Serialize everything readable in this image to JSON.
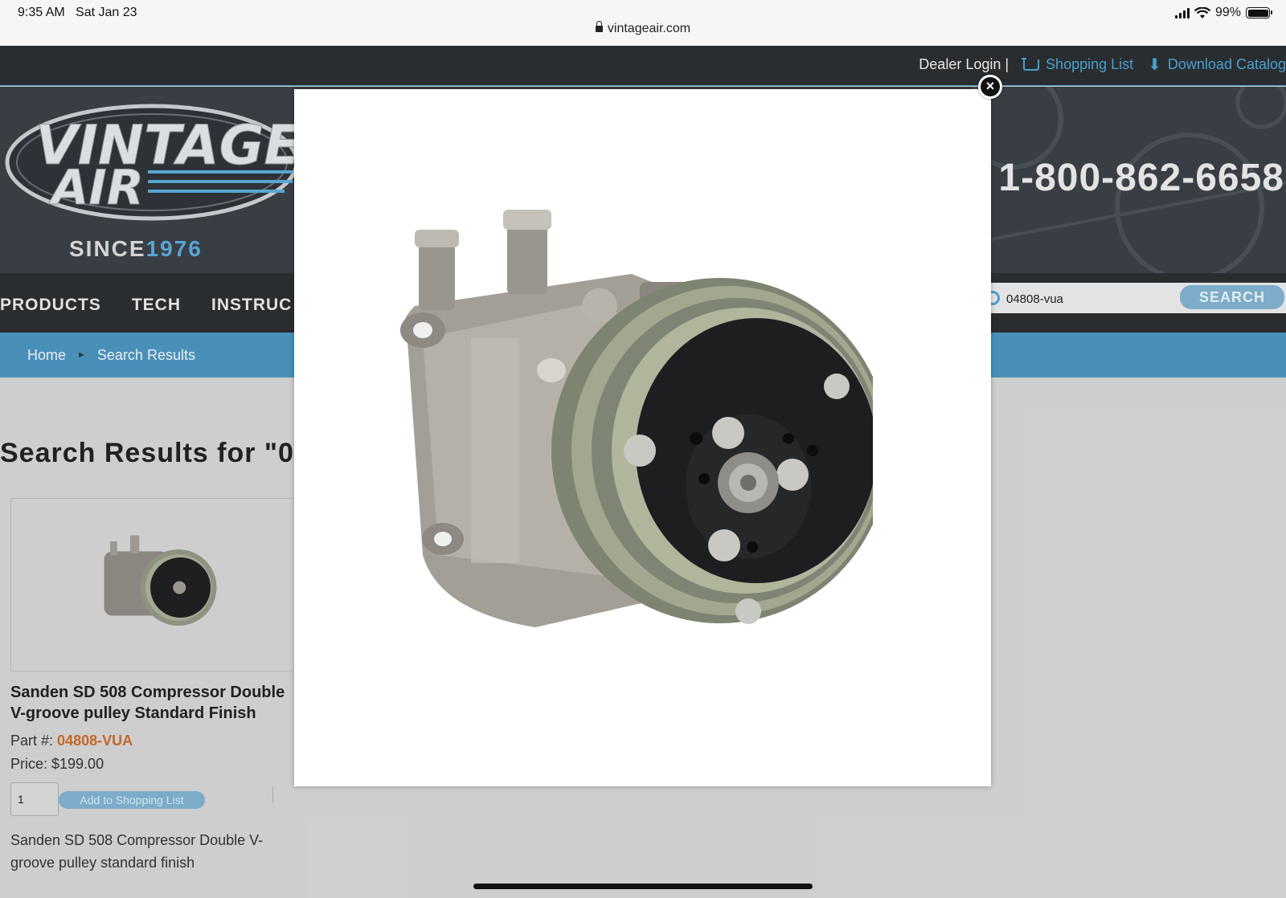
{
  "status_bar": {
    "time": "9:35 AM",
    "date": "Sat Jan 23",
    "battery": "99%",
    "url": "vintageair.com"
  },
  "topbar": {
    "dealer_login": "Dealer Login |",
    "shopping_list": "Shopping List",
    "download_catalog": "Download Catalog"
  },
  "header": {
    "since_label": "SINCE",
    "since_year": "1976",
    "phone": "1-800-862-6658"
  },
  "nav": {
    "items": [
      "PRODUCTS",
      "TECH",
      "INSTRUC"
    ],
    "search_value": "04808-vua",
    "search_button": "SEARCH"
  },
  "breadcrumb": {
    "home": "Home",
    "sep": "►",
    "current": "Search Results"
  },
  "results": {
    "title": "Search Results for \"0"
  },
  "product": {
    "name": "Sanden SD 508 Compressor Double V-groove pulley Standard Finish",
    "part_label": "Part #:",
    "part_number": "04808-VUA",
    "price": "Price: $199.00",
    "quantity": "1",
    "add_button": "Add to Shopping List",
    "description": "Sanden SD 508 Compressor Double V-groove pulley standard finish"
  },
  "modal": {
    "close_symbol": "×"
  },
  "colors": {
    "accent_blue": "#4aa3d4",
    "breadcrumb_blue": "#4b93bd",
    "dark_bar": "#2b2e31",
    "part_orange": "#c86a2a"
  }
}
